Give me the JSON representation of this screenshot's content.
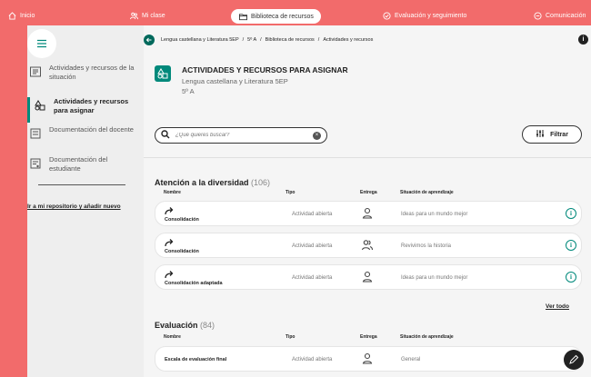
{
  "topnav": {
    "items": [
      {
        "icon": "home-icon",
        "label": "Inicio"
      },
      {
        "icon": "people-icon",
        "label": "Mi clase"
      },
      {
        "icon": "folder-icon",
        "label": "Biblioteca de recursos"
      },
      {
        "icon": "check-badge-icon",
        "label": "Evaluación y seguimiento"
      },
      {
        "icon": "chat-icon",
        "label": "Comunicación"
      }
    ],
    "active_index": 2
  },
  "sidebar": {
    "items": [
      {
        "icon": "list-box-icon",
        "label": "Actividades y recursos de la situación"
      },
      {
        "icon": "shapes-icon",
        "label": "Actividades y recursos para asignar"
      },
      {
        "icon": "document-icon",
        "label": "Documentación del docente"
      },
      {
        "icon": "document-user-icon",
        "label": "Documentación del estudiante"
      }
    ],
    "active_index": 1,
    "link": "Ir a mi repositorio y añadir nuevo"
  },
  "breadcrumb": {
    "items": [
      "Lengua castellana y Literatura 5EP",
      "5º A",
      "Biblioteca de recursos",
      "Actividades y recursos"
    ],
    "separator": "/"
  },
  "header": {
    "title": "ACTIVIDADES Y RECURSOS PARA ASIGNAR",
    "subject": "Lengua castellana y Literatura 5EP",
    "group": "5º A"
  },
  "search": {
    "placeholder": "¿Qué quieres buscar?",
    "value": ""
  },
  "filter_label": "Filtrar",
  "columns": {
    "name": "Nombre",
    "type": "Tipo",
    "delivery": "Entrega",
    "situation": "Situación de aprendizaje"
  },
  "sections": [
    {
      "title": "Atención a la diversidad",
      "count": "(106)",
      "rows": [
        {
          "name": "Consolidación",
          "type": "Actividad abierta",
          "delivery": "individual",
          "situation": "Ideas para un mundo mejor"
        },
        {
          "name": "Consolidación",
          "type": "Actividad abierta",
          "delivery": "group",
          "situation": "Revivimos la historia"
        },
        {
          "name": "Consolidación adaptada",
          "type": "Actividad abierta",
          "delivery": "individual",
          "situation": "Ideas para un mundo mejor"
        }
      ],
      "see_all": "Ver todo"
    },
    {
      "title": "Evaluación",
      "count": "(84)",
      "rows": [
        {
          "name": "Escala de evaluación final",
          "type": "Actividad abierta",
          "delivery": "individual",
          "situation": "General"
        }
      ]
    }
  ],
  "colors": {
    "brand": "#f26b6b",
    "accent": "#00897b",
    "page_bg": "#eeeeee"
  }
}
